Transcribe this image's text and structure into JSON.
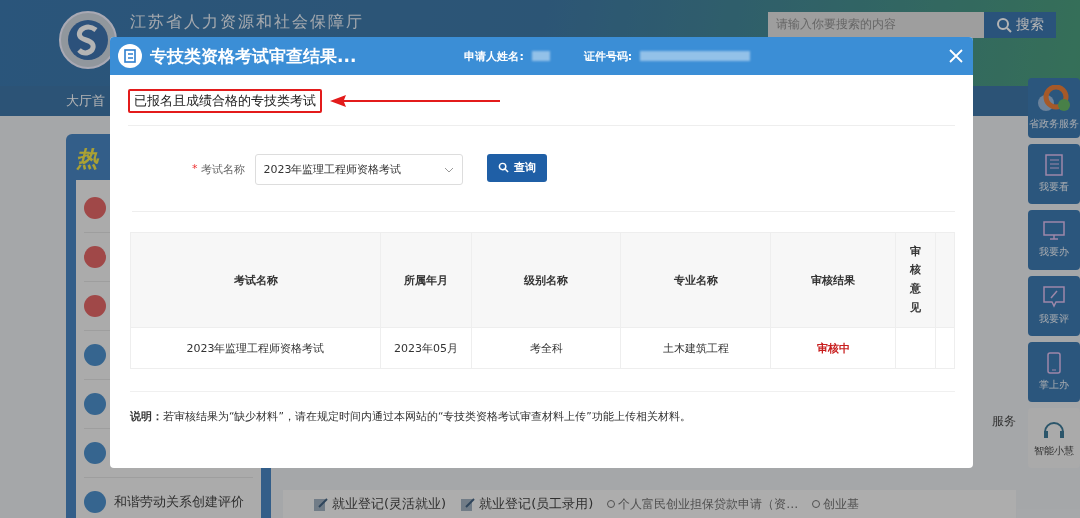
{
  "page": {
    "org_name": "江苏省人力资源和社会保障厅",
    "nav_item": "大厅首",
    "search": {
      "placeholder": "请输入你要搜索的内容",
      "button": "搜索"
    },
    "hot_panel": {
      "heading": "热",
      "items": [
        {
          "color": "#a04848"
        },
        {
          "color": "#a04848"
        },
        {
          "color": "#a04848"
        },
        {
          "color": "#36658f"
        },
        {
          "color": "#36658f"
        },
        {
          "color": "#36658f"
        },
        {
          "color": "#36658f",
          "label": "和谐劳动关系创建评价"
        }
      ]
    },
    "side_buttons": [
      {
        "kind": "cloud",
        "label": "省政务服务"
      },
      {
        "kind": "book",
        "label": "我要看"
      },
      {
        "kind": "monitor",
        "label": "我要办"
      },
      {
        "kind": "comment",
        "label": "我要评"
      },
      {
        "kind": "phone",
        "label": "掌上办"
      },
      {
        "kind": "headset",
        "label": "智能小慧"
      }
    ],
    "right_panel_text": "服务",
    "bottom_links": [
      "就业登记(灵活就业)",
      "就业登记(员工录用)"
    ],
    "news": [
      "个人富民创业担保贷款申请（资…",
      "创业基"
    ]
  },
  "modal": {
    "title": "专技类资格考试审查结果...",
    "applicant_label": "申请人姓名:",
    "id_label": "证件号码:",
    "section_label": "已报名且成绩合格的专技类考试",
    "form": {
      "label": "考试名称",
      "required_mark": "*",
      "value": "2023年监理工程师资格考试",
      "button": "查询"
    },
    "table": {
      "columns": [
        "考试名称",
        "所属年月",
        "级别名称",
        "专业名称",
        "审核结果",
        "审核意见"
      ],
      "rows": [
        {
          "cells": [
            "2023年监理工程师资格考试",
            "2023年05月",
            "考全科",
            "土木建筑工程",
            "审核中"
          ]
        }
      ]
    },
    "note": "**说明：**若审核结果为“缺少材料”，请在规定时间内通过本网站的“专技类资格考试审查材料上传”功能上传相关材料。"
  }
}
